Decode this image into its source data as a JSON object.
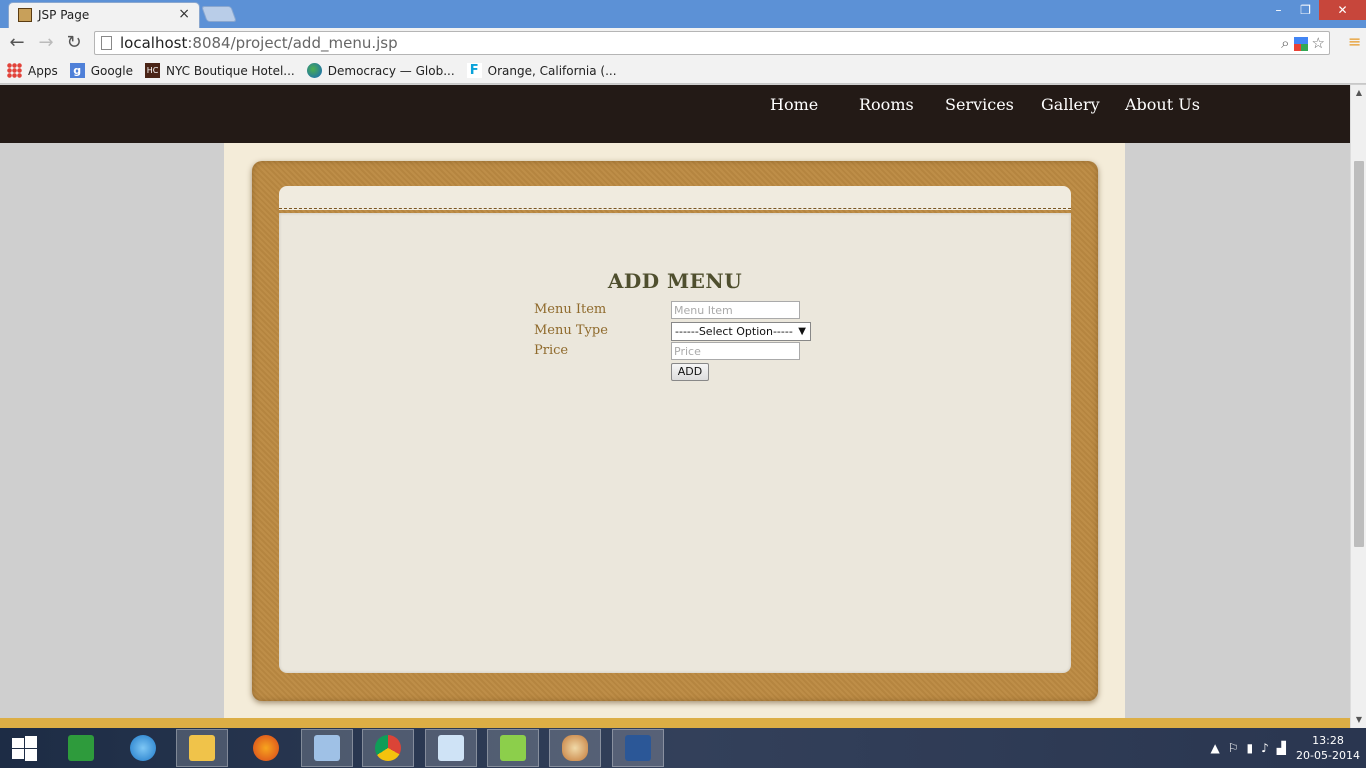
{
  "browser": {
    "tab": {
      "title": "JSP Page",
      "close": "×"
    },
    "window": {
      "minimize": "–",
      "maximize": "❐",
      "close": "✕"
    },
    "nav": {
      "back": "←",
      "forward": "→",
      "reload": "↻"
    },
    "address": {
      "host": "localhost",
      "rest": ":8084/project/add_menu.jsp"
    },
    "bookmarks": [
      {
        "label": "Apps",
        "icon": "apps-grid-icon"
      },
      {
        "label": "Google",
        "icon": "google-icon"
      },
      {
        "label": "NYC Boutique Hotel...",
        "icon": "hc-icon"
      },
      {
        "label": "Democracy — Glob...",
        "icon": "globe-icon"
      },
      {
        "label": "Orange, California (...",
        "icon": "f-icon"
      }
    ]
  },
  "site": {
    "nav": [
      "Home",
      "Rooms",
      "Services",
      "Gallery",
      "About Us"
    ]
  },
  "form": {
    "title": "ADD MENU",
    "menu_item": {
      "label": "Menu Item",
      "placeholder": "Menu Item"
    },
    "menu_type": {
      "label": "Menu Type",
      "selected": "------Select Option-----",
      "arrow": "▼"
    },
    "price": {
      "label": "Price",
      "placeholder": "Price"
    },
    "submit": "ADD"
  },
  "taskbar": {
    "clock": {
      "time": "13:28",
      "date": "20-05-2014"
    },
    "tray_up": "▲"
  },
  "colors": {
    "header_bg": "#231a16",
    "frame": "#bc8a42",
    "label": "#8f6a2c",
    "title": "#4f4f2e"
  }
}
